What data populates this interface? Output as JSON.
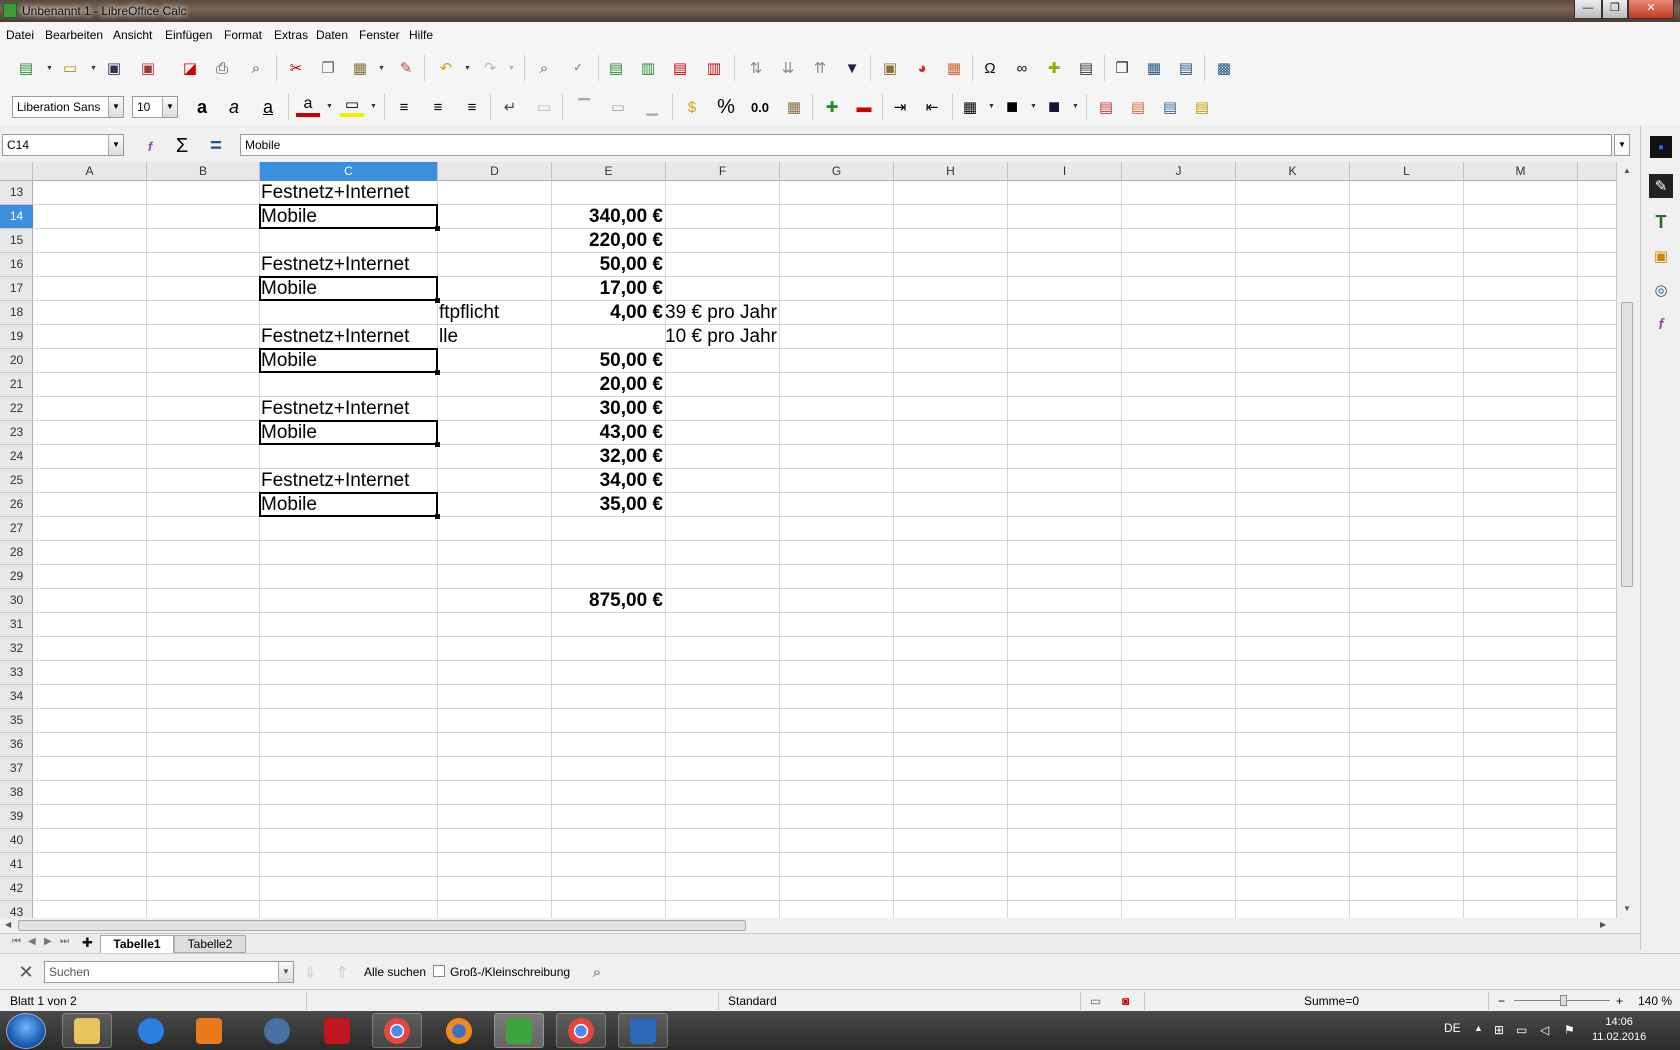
{
  "window": {
    "title": "Unbenannt 1 - LibreOffice Calc",
    "minimize": "—",
    "restore": "❐",
    "close": "✕"
  },
  "menu": [
    "Datei",
    "Bearbeiten",
    "Ansicht",
    "Einfügen",
    "Format",
    "Extras",
    "Daten",
    "Fenster",
    "Hilfe"
  ],
  "formatting": {
    "font_name": "Liberation Sans",
    "font_size": "10",
    "percent": "%",
    "decimal": "0.0"
  },
  "formula_bar": {
    "cell_ref": "C14",
    "content": "Mobile"
  },
  "columns": [
    "A",
    "B",
    "C",
    "D",
    "E",
    "F",
    "G",
    "H",
    "I",
    "J",
    "K",
    "L",
    "M"
  ],
  "selected_column": "C",
  "rows": [
    "13",
    "14",
    "15",
    "16",
    "17",
    "18",
    "19",
    "20",
    "21",
    "22",
    "23",
    "24",
    "25",
    "26",
    "27",
    "28",
    "29",
    "30",
    "31",
    "32",
    "33",
    "34",
    "35",
    "36",
    "37",
    "38",
    "39",
    "40",
    "41",
    "42",
    "43"
  ],
  "selected_row": "14",
  "cells": {
    "C13": "Festnetz+Internet",
    "C14": "Mobile",
    "E14": "340,00 €",
    "E15": "220,00 €",
    "C16": "Festnetz+Internet",
    "E16": "50,00 €",
    "C17": "Mobile",
    "E17": "17,00 €",
    "D18": "ftpflicht",
    "E18": "4,00 €",
    "F18": "39 € pro Jahr",
    "C19": "Festnetz+Internet",
    "D19": "lle",
    "F19": "10 € pro Jahr",
    "C20": "Mobile",
    "E20": "50,00 €",
    "E21": "20,00 €",
    "C22": "Festnetz+Internet",
    "E22": "30,00 €",
    "C23": "Mobile",
    "E23": "43,00 €",
    "E24": "32,00 €",
    "C25": "Festnetz+Internet",
    "E25": "34,00 €",
    "C26": "Mobile",
    "E26": "35,00 €",
    "E30": "875,00 €"
  },
  "sheets": {
    "add": "✚",
    "tabs": [
      "Tabelle1",
      "Tabelle2"
    ],
    "active": "Tabelle1"
  },
  "find": {
    "placeholder": "Suchen",
    "find_all": "Alle suchen",
    "match_case": "Groß-/Kleinschreibung"
  },
  "status": {
    "sheet": "Blatt 1 von 2",
    "style": "Standard",
    "sum": "Summe=0",
    "zoom": "140 %",
    "zoom_minus": "−",
    "zoom_plus": "+"
  },
  "taskbar": {
    "lang": "DE",
    "time": "14:06",
    "date": "11.02.2016"
  },
  "colors": {
    "accent": "#3c8fde",
    "title_bar": "#6b5646",
    "taskbar": "#2f2f2d"
  }
}
